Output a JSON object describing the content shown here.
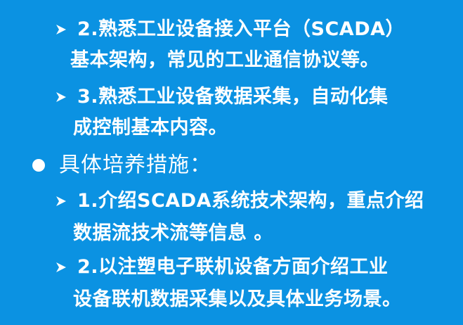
{
  "items": [
    {
      "line1": "2.熟悉工业设备接入平台（SCADA）",
      "line2": "基本架构，常见的工业通信协议等。"
    },
    {
      "line1": "3.熟悉工业设备数据采集，自动化集",
      "line2": "成控制基本内容。"
    },
    {
      "heading": "具体培养措施："
    },
    {
      "line1": "1.介绍SCADA系统技术架构，重点介绍",
      "line2": "数据流技术流等信息 。"
    },
    {
      "line1": "2.以注塑电子联机设备方面介绍工业",
      "line2": "设备联机数据采集以及具体业务场景。"
    }
  ],
  "colors": {
    "background": "#0B92E2",
    "text": "#FFFFFF"
  },
  "icons": {
    "sub_bullet": "arrow-right-icon",
    "main_bullet": "filled-circle-icon"
  }
}
